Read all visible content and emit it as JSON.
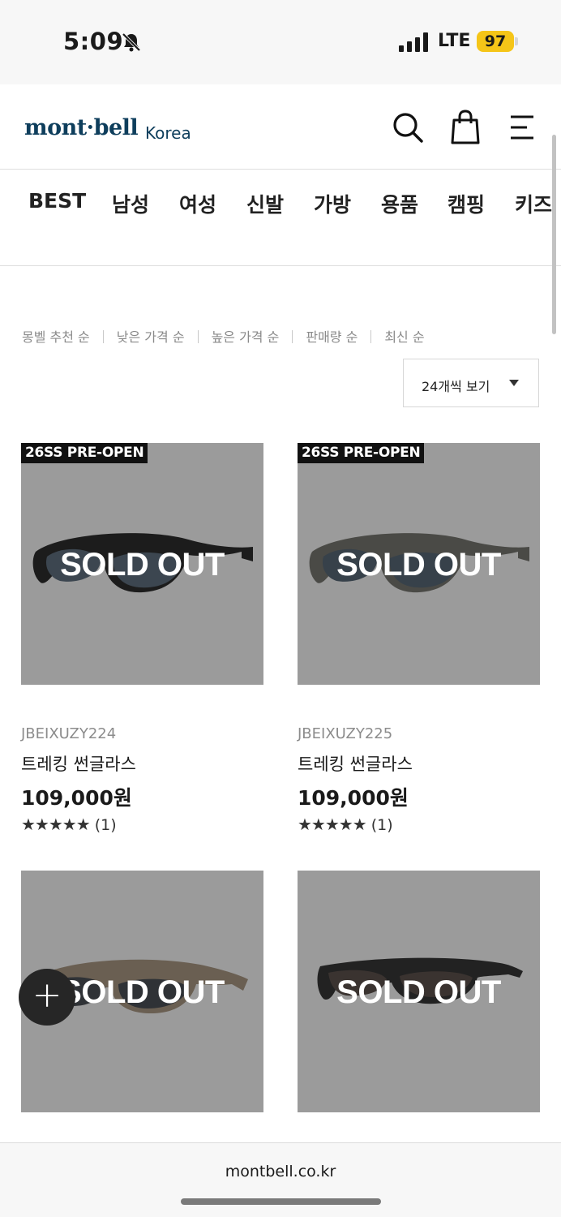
{
  "status": {
    "time": "5:09",
    "network": "LTE",
    "battery": "97"
  },
  "header": {
    "logo": "mont·bell",
    "logo_sub": "Korea"
  },
  "categories": [
    "BEST",
    "남성",
    "여성",
    "신발",
    "가방",
    "용품",
    "캠핑",
    "키즈"
  ],
  "sort": {
    "options": [
      "몽벨 추천 순",
      "낮은 가격 순",
      "높은 가격 순",
      "판매량 순",
      "최신 순"
    ],
    "view_label": "24개씩 보기"
  },
  "products": [
    {
      "badge": "26SS PRE-OPEN",
      "overlay": "SOLD OUT",
      "code": "JBEIXUZY224",
      "name": "트레킹 썬글라스",
      "price": "109,000원",
      "rating": "(1)",
      "stars": 5
    },
    {
      "badge": "26SS PRE-OPEN",
      "overlay": "SOLD OUT",
      "code": "JBEIXUZY225",
      "name": "트레킹 썬글라스",
      "price": "109,000원",
      "rating": "(1)",
      "stars": 5
    },
    {
      "badge": "",
      "overlay": "SOLD OUT",
      "code": "",
      "name": "",
      "price": "",
      "rating": ""
    },
    {
      "badge": "",
      "overlay": "SOLD OUT",
      "code": "",
      "name": "",
      "price": "",
      "rating": ""
    }
  ],
  "fab": {
    "label": "+"
  },
  "browser": {
    "url": "montbell.co.kr"
  },
  "icons": {
    "bell": "bell-slash-icon",
    "search": "search-icon",
    "bag": "shopping-bag-icon",
    "menu": "menu-icon",
    "add": "plus-icon"
  },
  "colors": {
    "brand": "#0e3e5c",
    "battery": "#f5c518",
    "soldout_bg": "#9b9b9b"
  }
}
